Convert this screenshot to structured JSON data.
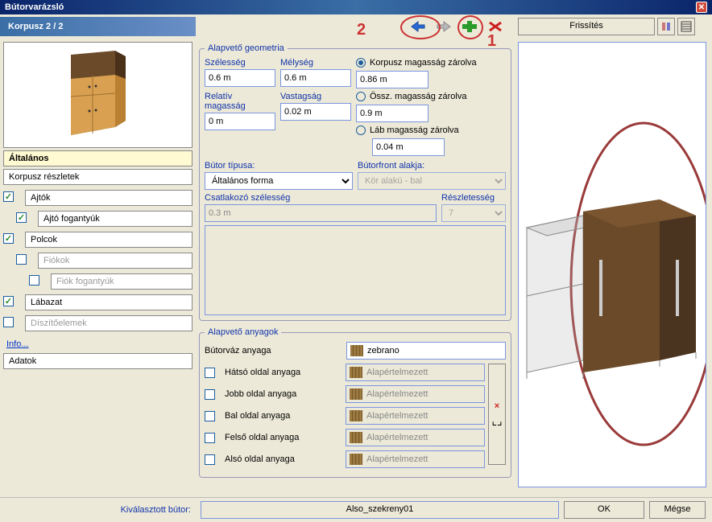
{
  "window": {
    "title": "Bútorvarázsló"
  },
  "toolbar": {
    "korpusz_label": "Korpusz 2 / 2",
    "refresh": "Frissítés",
    "annot1": "1",
    "annot2": "2"
  },
  "tree": {
    "altalanos": "Általános",
    "korpusz_reszletek": "Korpusz részletek",
    "ajtok": "Ajtók",
    "ajto_fogantyuk": "Ajtó fogantyúk",
    "polcok": "Polcok",
    "fiokok": "Fiókok",
    "fiok_fogantyuk": "Fiók fogantyúk",
    "labazat": "Lábazat",
    "diszitoelemek": "Díszítőelemek",
    "info": "Info...",
    "adatok": "Adatok"
  },
  "geom": {
    "legend": "Alapvető geometria",
    "szelesseg_l": "Szélesség",
    "szelesseg": "0.6 m",
    "melyseg_l": "Mélység",
    "melyseg": "0.6 m",
    "relmag_l": "Relatív magasság",
    "relmag": "0 m",
    "vastagsag_l": "Vastagság",
    "vastagsag": "0.02 m",
    "r1": "Korpusz magasság zárolva",
    "r1v": "0.86 m",
    "r2": "Össz. magasság zárolva",
    "r2v": "0.9 m",
    "r3": "Láb magasság zárolva",
    "r3v": "0.04 m",
    "butortipus_l": "Bútor típusa:",
    "butortipus": "Általános forma",
    "butorfront_l": "Bútorfront alakja:",
    "butorfront": "Kör alakú - bal",
    "csatl_l": "Csatlakozó szélesség",
    "csatl": "0.3 m",
    "reszl_l": "Részletesség",
    "reszl": "7"
  },
  "mat": {
    "legend": "Alapvető anyagok",
    "frame_l": "Bútorváz anyaga",
    "frame": "zebrano",
    "default": "Alapértelmezett",
    "back": "Hátsó oldal anyaga",
    "right": "Jobb oldal anyaga",
    "left": "Bal oldal anyaga",
    "top": "Felső oldal anyaga",
    "bottom": "Alsó oldal anyaga"
  },
  "bottom": {
    "sel_label": "Kiválasztott bútor:",
    "sel_value": "Also_szekreny01",
    "ok": "OK",
    "cancel": "Mégse"
  }
}
